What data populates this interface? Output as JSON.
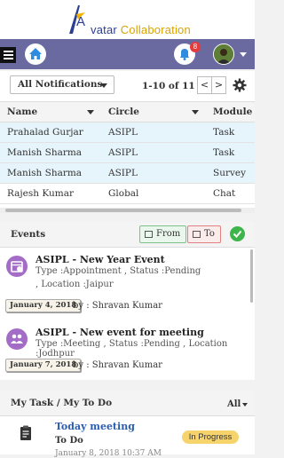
{
  "brand": {
    "first_letter": "A",
    "name_part": "vatar",
    "collab_part": "Collaboration"
  },
  "header": {
    "notification_count": "8"
  },
  "notifications": {
    "filter_value": "All Notifications",
    "page_info": "1-10 of 11",
    "prev_symbol": "<",
    "next_symbol": ">",
    "columns": [
      "Name",
      "Circle",
      "Module"
    ],
    "rows": [
      {
        "name": "Prahalad Gurjar",
        "circle": "ASIPL",
        "module": "Task",
        "highlight": true
      },
      {
        "name": "Manish Sharma",
        "circle": "ASIPL",
        "module": "Task",
        "highlight": true
      },
      {
        "name": "Manish Sharma",
        "circle": "ASIPL",
        "module": "Survey",
        "highlight": true
      },
      {
        "name": "Rajesh Kumar",
        "circle": "Global",
        "module": "Chat",
        "highlight": false
      }
    ]
  },
  "events": {
    "title": "Events",
    "from_label": "From",
    "to_label": "To",
    "items": [
      {
        "title": "ASIPL - New Year Event",
        "meta_line1": "Type :Appointment    , Status :Pending",
        "meta_line2": ", Location :Jaipur",
        "date": "January 4, 2018",
        "by": "by : Shravan Kumar"
      },
      {
        "title": "ASIPL - New event for meeting",
        "meta_line1": "Type :Meeting  , Status :Pending  , Location :Jodhpur",
        "meta_line2": "",
        "date": "January 7, 2018",
        "by": "by : Shravan Kumar"
      }
    ]
  },
  "tasks": {
    "title": "My Task / My To Do",
    "filter_value": "All",
    "item": {
      "title": "Today meeting",
      "type": "To Do",
      "time": "January 8, 2018 10:37 AM",
      "status": "In Progress"
    }
  },
  "colors": {
    "nav": "#6a6aa0",
    "accent_purple": "#a36cc6",
    "status_in_progress": "#f6d36b",
    "ok_green": "#3db54a"
  }
}
